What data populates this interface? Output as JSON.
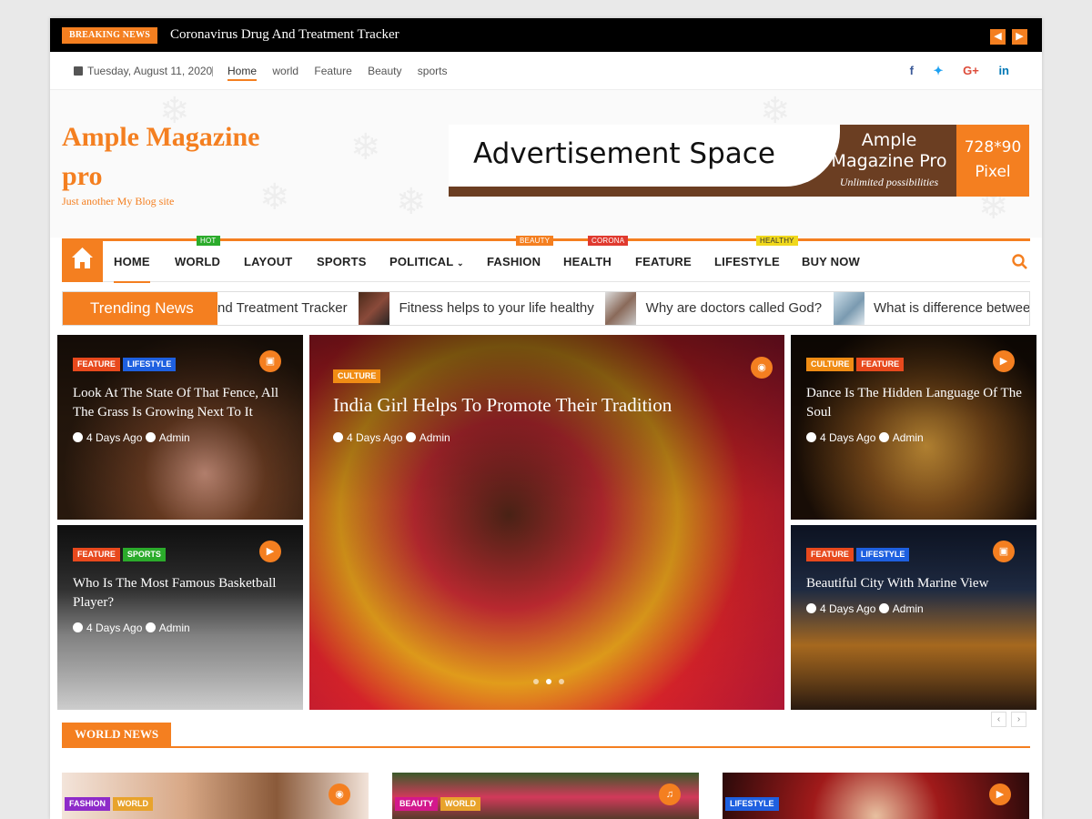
{
  "breaking": {
    "label": "BREAKING NEWS",
    "title": "Coronavirus Drug And Treatment Tracker",
    "prev_icon": "chevron-left-icon",
    "next_icon": "chevron-right-icon"
  },
  "topbar": {
    "date": "Tuesday, August 11, 2020",
    "links": [
      "Home",
      "world",
      "Feature",
      "Beauty",
      "sports"
    ],
    "social": [
      {
        "name": "facebook-icon",
        "glyph": "f",
        "color": "#3b5998"
      },
      {
        "name": "twitter-icon",
        "glyph": "t",
        "color": "#1da1f2"
      },
      {
        "name": "google-plus-icon",
        "glyph": "G+",
        "color": "#dd4b39"
      },
      {
        "name": "linkedin-icon",
        "glyph": "in",
        "color": "#0077b5"
      }
    ]
  },
  "site": {
    "title": "Ample Magazine pro",
    "tagline": "Just another My Blog site"
  },
  "ad": {
    "text": "Advertisement Space",
    "brand": "Ample Magazine Pro",
    "slogan": "Unlimited possibilities",
    "size_line1": "728*90",
    "size_line2": "Pixel"
  },
  "nav": {
    "items": [
      {
        "label": "HOME",
        "badge": ""
      },
      {
        "label": "WORLD",
        "badge": "HOT",
        "badge_color": "#2bab2b"
      },
      {
        "label": "LAYOUT",
        "badge": ""
      },
      {
        "label": "SPORTS",
        "badge": ""
      },
      {
        "label": "POLITICAL",
        "badge": "",
        "dropdown": true
      },
      {
        "label": "FASHION",
        "badge": "BEAUTY",
        "badge_color": "#f47f20"
      },
      {
        "label": "HEALTH",
        "badge": "CORONA",
        "badge_color": "#e03a2f"
      },
      {
        "label": "FEATURE",
        "badge": ""
      },
      {
        "label": "LIFESTYLE",
        "badge": "HEALTHY",
        "badge_color": "#f0d81c"
      },
      {
        "label": "BUY NOW",
        "badge": ""
      }
    ]
  },
  "trending": {
    "label": "Trending News",
    "items": [
      "nd Treatment Tracker",
      "Fitness helps to your life healthy",
      "Why are doctors called God?",
      "What is difference between ope"
    ]
  },
  "cards": [
    {
      "tags": [
        "FEATURE",
        "LIFESTYLE"
      ],
      "title": "Look At The State Of That Fence, All The Grass Is Growing Next To It",
      "time": "4 Days Ago",
      "author": "Admin",
      "icon": "image-icon"
    },
    {
      "tags": [
        "FEATURE",
        "SPORTS"
      ],
      "title": "Who Is The Most Famous Basketball Player?",
      "time": "4 Days Ago",
      "author": "Admin",
      "icon": "video-icon"
    },
    {
      "tags": [
        "CULTURE"
      ],
      "title": "India Girl Helps To Promote Their Tradition",
      "time": "4 Days Ago",
      "author": "Admin",
      "icon": "camera-icon"
    },
    {
      "tags": [
        "CULTURE",
        "FEATURE"
      ],
      "title": "Dance Is The Hidden Language Of The Soul",
      "time": "4 Days Ago",
      "author": "Admin",
      "icon": "video-icon"
    },
    {
      "tags": [
        "FEATURE",
        "LIFESTYLE"
      ],
      "title": "Beautiful City With Marine View",
      "time": "4 Days Ago",
      "author": "Admin",
      "icon": "image-icon"
    }
  ],
  "section": {
    "label": "WORLD NEWS"
  },
  "bottom_cards": [
    {
      "tags": [
        "FASHION",
        "WORLD"
      ],
      "icon": "camera-icon"
    },
    {
      "tags": [
        "BEAUTY",
        "WORLD"
      ],
      "icon": "audio-icon"
    },
    {
      "tags": [
        "LIFESTYLE"
      ],
      "icon": "video-icon"
    }
  ],
  "colors": {
    "accent": "#f47f20",
    "feature": "#e8491d",
    "lifestyle": "#1e60e0",
    "sports": "#2bab2b",
    "culture": "#f08c14",
    "fashion": "#8e2bc9",
    "world": "#e8a32c",
    "beauty": "#d3188c"
  }
}
